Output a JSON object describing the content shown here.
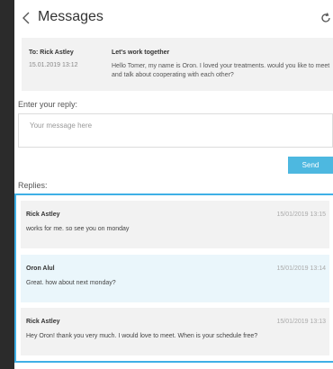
{
  "header": {
    "title": "Messages",
    "back_icon": "chevron-left-icon",
    "refresh_icon": "refresh-icon"
  },
  "message": {
    "to": "To: Rick Astley",
    "date": "15.01.2019 13:12",
    "subject": "Let's work together",
    "body": "Hello Tomer, my name is Oron. I loved your treatments. would you like to meet and talk about cooperating with each other?"
  },
  "reply": {
    "label": "Enter your reply:",
    "placeholder": "Your message here",
    "send_label": "Send"
  },
  "replies": {
    "label": "Replies:",
    "items": [
      {
        "author": "Rick Astley",
        "date": "15/01/2019 13:15",
        "text": "works for me. so see you on monday",
        "bg": "#f2f2f2"
      },
      {
        "author": "Oron Alul",
        "date": "15/01/2019 13:14",
        "text": "Great. how about next monday?",
        "bg": "#eaf6fb"
      },
      {
        "author": "Rick Astley",
        "date": "15/01/2019 13:13",
        "text": "Hey Oron! thank you very much. I would love to meet. When is your schedule free?",
        "bg": "#f2f2f2"
      }
    ]
  },
  "colors": {
    "accent": "#4db8e0",
    "highlight_border": "#3fb0e6",
    "page_bg": "#2b2b2b"
  }
}
